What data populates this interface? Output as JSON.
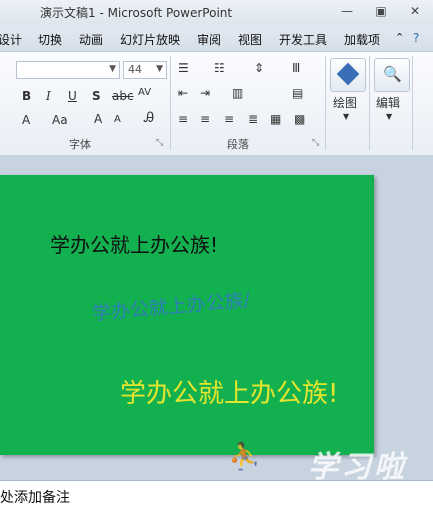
{
  "window": {
    "title": "演示文稿1 - Microsoft PowerPoint",
    "controls": [
      "minimize",
      "restore",
      "close"
    ]
  },
  "tabs": [
    {
      "label": "设计"
    },
    {
      "label": "切换"
    },
    {
      "label": "动画"
    },
    {
      "label": "幻灯片放映"
    },
    {
      "label": "审阅"
    },
    {
      "label": "视图"
    },
    {
      "label": "开发工具"
    },
    {
      "label": "加载项"
    }
  ],
  "ribbon": {
    "font_size_value": "44",
    "font_group_label": "字体",
    "paragraph_group_label": "段落",
    "draw_label": "绘图",
    "edit_label": "编辑"
  },
  "slide": {
    "text1": "学办公就上办公族!",
    "text2": "学办公就上办公族/",
    "text3": "学办公就上办公族!",
    "background": "#12b04f",
    "text_colors": [
      "#111111",
      "#2d7fb5",
      "#e4e52d"
    ]
  },
  "watermark": "学习啦",
  "notes_placeholder": "处添加备注"
}
